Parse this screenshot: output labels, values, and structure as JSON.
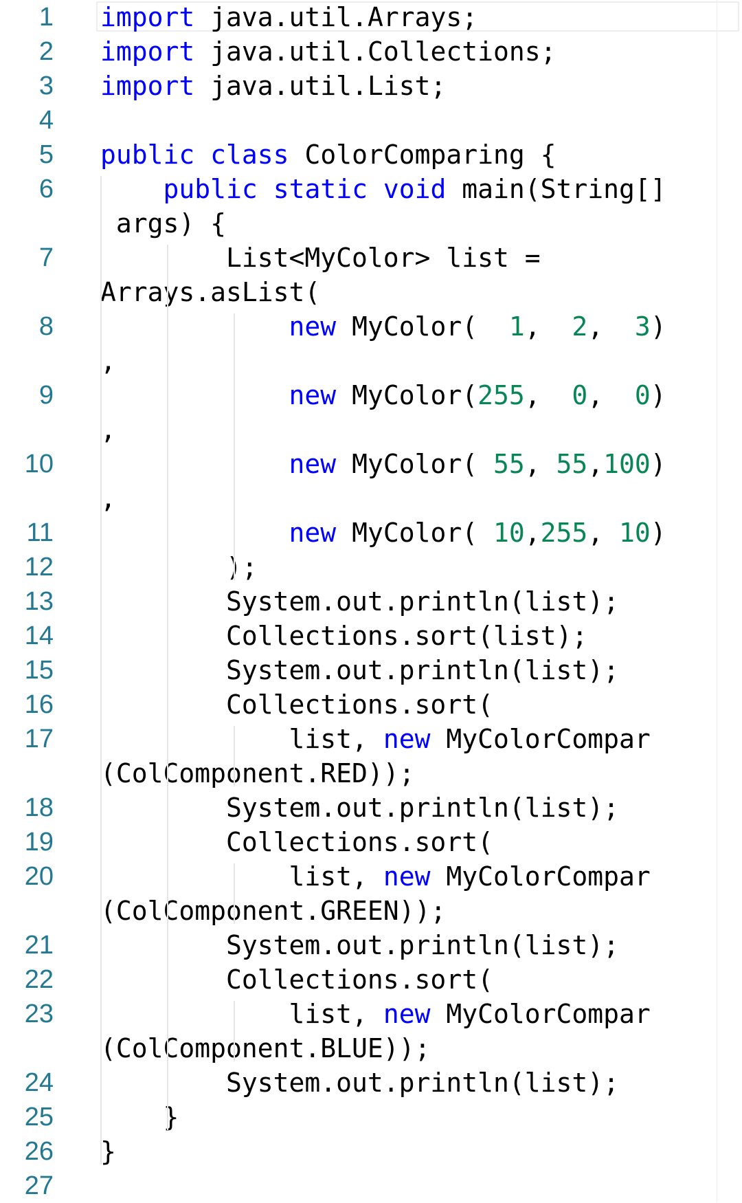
{
  "editor": {
    "line_numbers": [
      "1",
      "2",
      "3",
      "4",
      "5",
      "6",
      "7",
      "8",
      "9",
      "10",
      "11",
      "12",
      "13",
      "14",
      "15",
      "16",
      "17",
      "18",
      "19",
      "20",
      "21",
      "22",
      "23",
      "24",
      "25",
      "26",
      "27"
    ],
    "colors": {
      "keyword": "#0000ff",
      "number": "#098658",
      "text": "#000000",
      "line_number": "#237893"
    },
    "rows": [
      [
        [
          "kw",
          "import"
        ],
        [
          "t",
          " java.util.Arrays;"
        ]
      ],
      [
        [
          "kw",
          "import"
        ],
        [
          "t",
          " java.util.Collections;"
        ]
      ],
      [
        [
          "kw",
          "import"
        ],
        [
          "t",
          " java.util.List;"
        ]
      ],
      [],
      [
        [
          "kw",
          "public"
        ],
        [
          "t",
          " "
        ],
        [
          "kw",
          "class"
        ],
        [
          "t",
          " ColorComparing {"
        ]
      ],
      [
        [
          "t",
          "    "
        ],
        [
          "kw",
          "public"
        ],
        [
          "t",
          " "
        ],
        [
          "kw",
          "static"
        ],
        [
          "t",
          " "
        ],
        [
          "kw",
          "void"
        ],
        [
          "t",
          " main(String[]"
        ]
      ],
      [
        [
          "t",
          " args) {"
        ]
      ],
      [
        [
          "t",
          "        List<MyColor> list ="
        ]
      ],
      [
        [
          "t",
          "Arrays.asList("
        ]
      ],
      [
        [
          "t",
          "            "
        ],
        [
          "kw",
          "new"
        ],
        [
          "t",
          " MyColor(  "
        ],
        [
          "num",
          "1"
        ],
        [
          "t",
          ",  "
        ],
        [
          "num",
          "2"
        ],
        [
          "t",
          ",  "
        ],
        [
          "num",
          "3"
        ],
        [
          "t",
          ")"
        ]
      ],
      [
        [
          "t",
          ","
        ]
      ],
      [
        [
          "t",
          "            "
        ],
        [
          "kw",
          "new"
        ],
        [
          "t",
          " MyColor("
        ],
        [
          "num",
          "255"
        ],
        [
          "t",
          ",  "
        ],
        [
          "num",
          "0"
        ],
        [
          "t",
          ",  "
        ],
        [
          "num",
          "0"
        ],
        [
          "t",
          ")"
        ]
      ],
      [
        [
          "t",
          ","
        ]
      ],
      [
        [
          "t",
          "            "
        ],
        [
          "kw",
          "new"
        ],
        [
          "t",
          " MyColor( "
        ],
        [
          "num",
          "55"
        ],
        [
          "t",
          ", "
        ],
        [
          "num",
          "55"
        ],
        [
          "t",
          ","
        ],
        [
          "num",
          "100"
        ],
        [
          "t",
          ")"
        ]
      ],
      [
        [
          "t",
          ","
        ]
      ],
      [
        [
          "t",
          "            "
        ],
        [
          "kw",
          "new"
        ],
        [
          "t",
          " MyColor( "
        ],
        [
          "num",
          "10"
        ],
        [
          "t",
          ","
        ],
        [
          "num",
          "255"
        ],
        [
          "t",
          ", "
        ],
        [
          "num",
          "10"
        ],
        [
          "t",
          ")"
        ]
      ],
      [
        [
          "t",
          "        );"
        ]
      ],
      [
        [
          "t",
          "        System.out.println(list);"
        ]
      ],
      [
        [
          "t",
          "        Collections.sort(list);"
        ]
      ],
      [
        [
          "t",
          "        System.out.println(list);"
        ]
      ],
      [
        [
          "t",
          "        Collections.sort("
        ]
      ],
      [
        [
          "t",
          "            list, "
        ],
        [
          "kw",
          "new"
        ],
        [
          "t",
          " MyColorCompar"
        ]
      ],
      [
        [
          "t",
          "(ColComponent.RED));"
        ]
      ],
      [
        [
          "t",
          "        System.out.println(list);"
        ]
      ],
      [
        [
          "t",
          "        Collections.sort("
        ]
      ],
      [
        [
          "t",
          "            list, "
        ],
        [
          "kw",
          "new"
        ],
        [
          "t",
          " MyColorCompar"
        ]
      ],
      [
        [
          "t",
          "(ColComponent.GREEN));"
        ]
      ],
      [
        [
          "t",
          "        System.out.println(list);"
        ]
      ],
      [
        [
          "t",
          "        Collections.sort("
        ]
      ],
      [
        [
          "t",
          "            list, "
        ],
        [
          "kw",
          "new"
        ],
        [
          "t",
          " MyColorCompar"
        ]
      ],
      [
        [
          "t",
          "(ColComponent.BLUE));"
        ]
      ],
      [
        [
          "t",
          "        System.out.println(list);"
        ]
      ],
      [
        [
          "t",
          "    }"
        ]
      ],
      [
        [
          "t",
          "}"
        ]
      ],
      []
    ]
  }
}
